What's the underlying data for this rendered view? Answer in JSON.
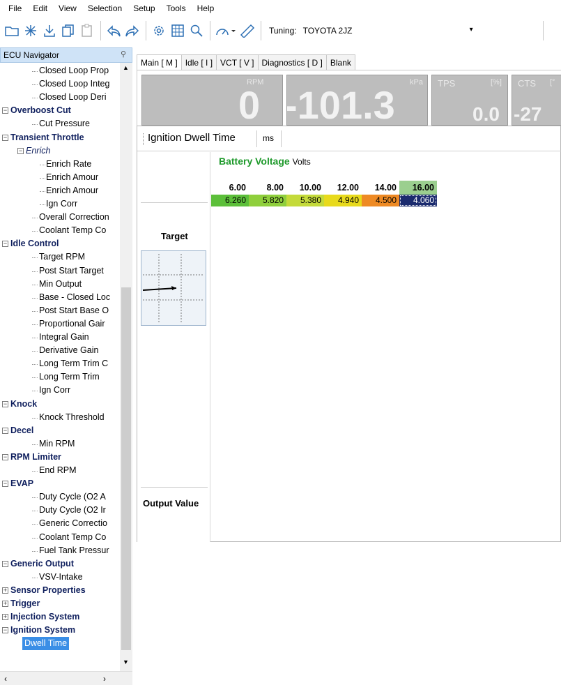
{
  "menu": [
    "File",
    "Edit",
    "View",
    "Selection",
    "Setup",
    "Tools",
    "Help"
  ],
  "toolbar": {
    "icons": [
      "open-folder-icon",
      "star-burst-icon",
      "download-icon",
      "copy-icon",
      "paste-icon",
      "undo-icon",
      "redo-icon",
      "settings-icon",
      "table-icon",
      "search-icon",
      "gauge-icon",
      "ruler-icon"
    ],
    "tuning_label": "Tuning:",
    "tuning_value": "TOYOTA 2JZ"
  },
  "navigator": {
    "title": "ECU Navigator",
    "items": [
      {
        "label": "Closed Loop Prop",
        "type": "leaf"
      },
      {
        "label": "Closed Loop Integ",
        "type": "leaf"
      },
      {
        "label": "Closed Loop Deri",
        "type": "leaf"
      },
      {
        "label": "Overboost Cut",
        "type": "cat"
      },
      {
        "label": "Cut Pressure",
        "type": "leaf"
      },
      {
        "label": "Transient Throttle",
        "type": "cat"
      },
      {
        "label": "Enrich",
        "type": "sub"
      },
      {
        "label": "Enrich Rate",
        "type": "leaf2"
      },
      {
        "label": "Enrich Amour",
        "type": "leaf2"
      },
      {
        "label": "Enrich Amour",
        "type": "leaf2"
      },
      {
        "label": "Ign Corr",
        "type": "leaf2"
      },
      {
        "label": "Overall Correction",
        "type": "leaf"
      },
      {
        "label": "Coolant Temp Co",
        "type": "leaf"
      },
      {
        "label": "Idle Control",
        "type": "cat"
      },
      {
        "label": "Target RPM",
        "type": "leaf"
      },
      {
        "label": "Post Start Target",
        "type": "leaf"
      },
      {
        "label": "Min Output",
        "type": "leaf"
      },
      {
        "label": "Base - Closed Loc",
        "type": "leaf"
      },
      {
        "label": "Post Start Base O",
        "type": "leaf"
      },
      {
        "label": "Proportional Gair",
        "type": "leaf"
      },
      {
        "label": "Integral Gain",
        "type": "leaf"
      },
      {
        "label": "Derivative Gain",
        "type": "leaf"
      },
      {
        "label": "Long Term Trim C",
        "type": "leaf"
      },
      {
        "label": "Long Term Trim",
        "type": "leaf"
      },
      {
        "label": "Ign Corr",
        "type": "leaf"
      },
      {
        "label": "Knock",
        "type": "cat"
      },
      {
        "label": "Knock Threshold",
        "type": "leaf"
      },
      {
        "label": "Decel",
        "type": "cat"
      },
      {
        "label": "Min RPM",
        "type": "leaf"
      },
      {
        "label": "RPM Limiter",
        "type": "cat"
      },
      {
        "label": "End RPM",
        "type": "leaf"
      },
      {
        "label": "EVAP",
        "type": "cat"
      },
      {
        "label": "Duty Cycle (O2 A",
        "type": "leaf"
      },
      {
        "label": "Duty Cycle (O2 Ir",
        "type": "leaf"
      },
      {
        "label": "Generic Correctio",
        "type": "leaf"
      },
      {
        "label": "Coolant Temp Co",
        "type": "leaf"
      },
      {
        "label": "Fuel Tank Pressur",
        "type": "leaf"
      },
      {
        "label": "Generic Output",
        "type": "cat"
      },
      {
        "label": "VSV-Intake",
        "type": "leaf"
      },
      {
        "label": "Sensor Properties",
        "type": "catc"
      },
      {
        "label": "Trigger",
        "type": "catc"
      },
      {
        "label": "Injection System",
        "type": "catc"
      },
      {
        "label": "Ignition System",
        "type": "cat"
      },
      {
        "label": "Dwell Time",
        "type": "selected"
      }
    ]
  },
  "tabs": [
    "Main [ M ]",
    "Idle [ I ]",
    "VCT [ V ]",
    "Diagnostics [ D ]",
    "Blank"
  ],
  "gauges": [
    {
      "unit": "RPM",
      "value": "0"
    },
    {
      "unit": "kPa",
      "value": "-101.3"
    },
    {
      "label": "TPS",
      "unit": "[%]",
      "value": "0.0"
    },
    {
      "label": "CTS",
      "unit": "[°",
      "value": "-27"
    }
  ],
  "table": {
    "name": "Ignition Dwell Time",
    "unit": "ms",
    "axis_name": "Battery Voltage",
    "axis_unit": "Volts",
    "target_label": "Target",
    "output_label": "Output Value",
    "columns": [
      "6.00",
      "8.00",
      "10.00",
      "12.00",
      "14.00",
      "16.00"
    ],
    "values": [
      "6.260",
      "5.820",
      "5.380",
      "4.940",
      "4.500",
      "4.060"
    ],
    "cell_colors": [
      "#5cbf3a",
      "#8fcf3c",
      "#c4da3a",
      "#e8da1c",
      "#ee8a24",
      "#1b2b6e"
    ]
  }
}
